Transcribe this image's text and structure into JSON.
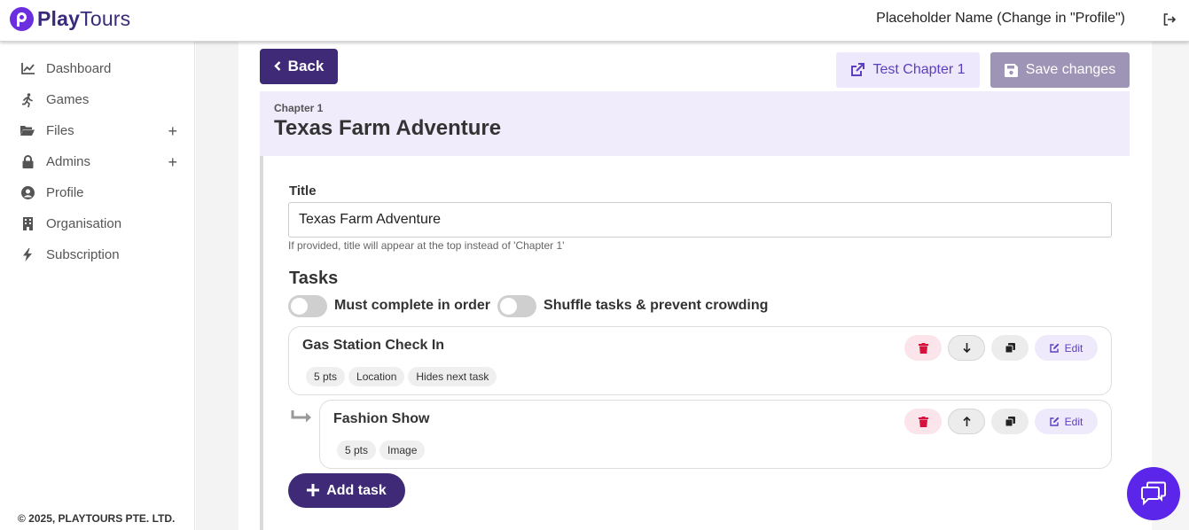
{
  "header": {
    "logo_play": "Play",
    "logo_tours": "Tours",
    "user_name": "Placeholder Name (Change in \"Profile\")"
  },
  "sidebar": {
    "items": [
      {
        "label": "Dashboard",
        "icon": "chart-line-icon"
      },
      {
        "label": "Games",
        "icon": "running-icon"
      },
      {
        "label": "Files",
        "icon": "folder-open-icon",
        "expandable": true
      },
      {
        "label": "Admins",
        "icon": "lock-icon",
        "expandable": true
      },
      {
        "label": "Profile",
        "icon": "user-circle-icon"
      },
      {
        "label": "Organisation",
        "icon": "building-icon"
      },
      {
        "label": "Subscription",
        "icon": "bolt-icon"
      }
    ],
    "expand_symbol": "+",
    "copyright": "© 2025, PLAYTOURS PTE. LTD."
  },
  "toolbar": {
    "back_label": "Back",
    "test_label": "Test Chapter 1",
    "save_label": "Save changes"
  },
  "chapter": {
    "label": "Chapter 1",
    "title": "Texas Farm Adventure"
  },
  "form": {
    "title_label": "Title",
    "title_value": "Texas Farm Adventure",
    "title_help": "If provided, title will appear at the top instead of 'Chapter 1'",
    "tasks_heading": "Tasks",
    "toggle_order_label": "Must complete in order",
    "toggle_shuffle_label": "Shuffle tasks & prevent crowding",
    "toggle_order_on": false,
    "toggle_shuffle_on": false
  },
  "tasks": [
    {
      "name": "Gas Station Check In",
      "tags": [
        "5 pts",
        "Location",
        "Hides next task"
      ],
      "edit_label": "Edit",
      "move": "down"
    },
    {
      "name": "Fashion Show",
      "tags": [
        "5 pts",
        "Image"
      ],
      "edit_label": "Edit",
      "move": "up",
      "indented": true
    }
  ],
  "add_task_label": "Add task",
  "colors": {
    "primary": "#3f2a78",
    "accent": "#5b25ea",
    "banner_bg": "#f0ecfb",
    "delete_bg": "#fbe4ea",
    "delete_icon": "#d4133f"
  }
}
